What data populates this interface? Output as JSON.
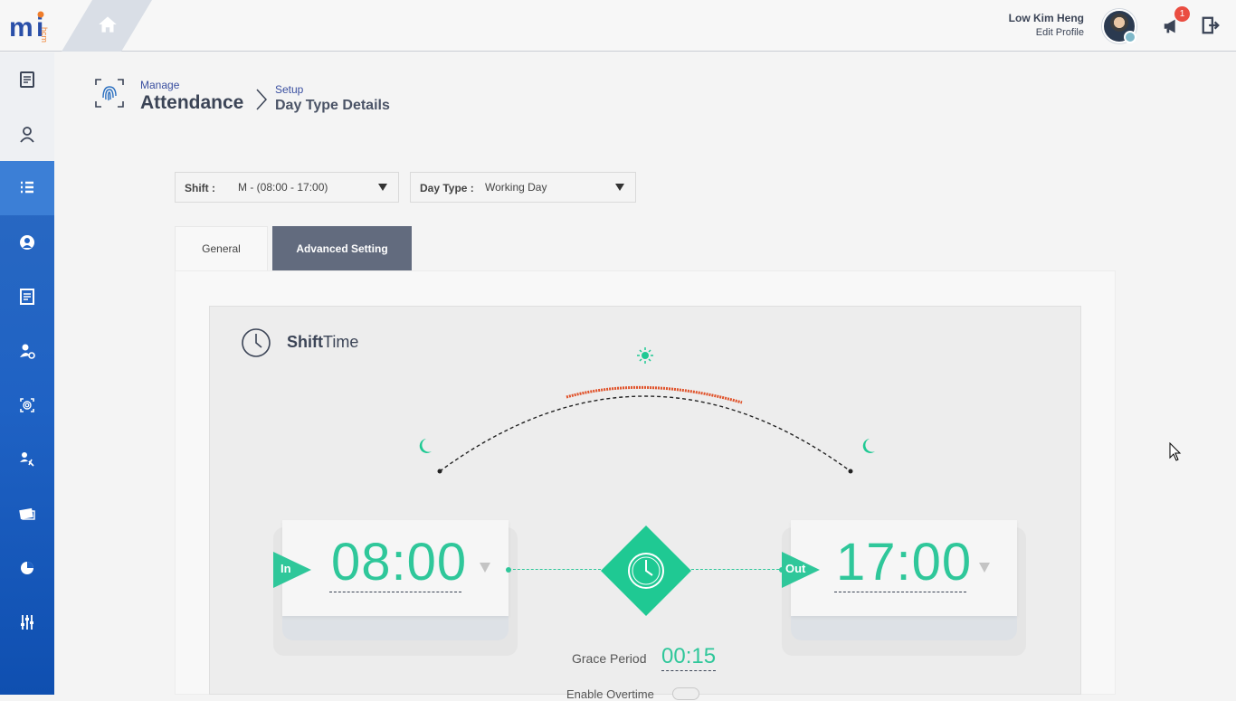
{
  "header": {
    "user_name": "Low Kim Heng",
    "edit_profile": "Edit Profile",
    "notifications_count": "1"
  },
  "breadcrumb": {
    "section": "Manage",
    "module": "Attendance",
    "subsection": "Setup",
    "page": "Day Type Details"
  },
  "filters": {
    "shift_label": "Shift :",
    "shift_value": "M - (08:00 - 17:00)",
    "daytype_label": "Day Type :",
    "daytype_value": "Working Day"
  },
  "tabs": [
    {
      "label": "General",
      "active": false
    },
    {
      "label": "Advanced Setting",
      "active": true
    }
  ],
  "shift_time": {
    "title_bold": "Shift",
    "title_rest": "Time",
    "in_label": "In",
    "in_time": "08:00",
    "out_label": "Out",
    "out_time": "17:00",
    "grace_label": "Grace Period",
    "grace_value": "00:15",
    "overtime_label": "Enable Overtime"
  },
  "sidebar": {
    "items": [
      {
        "icon": "notes-icon"
      },
      {
        "icon": "user-agent-icon"
      },
      {
        "icon": "list-icon"
      },
      {
        "icon": "profile-icon"
      },
      {
        "icon": "edit-document-icon"
      },
      {
        "icon": "user-settings-icon"
      },
      {
        "icon": "fingerprint-icon"
      },
      {
        "icon": "user-assign-icon"
      },
      {
        "icon": "payroll-icon"
      },
      {
        "icon": "pie-chart-icon"
      },
      {
        "icon": "sliders-icon"
      }
    ]
  },
  "colors": {
    "accent_green": "#2fc79a",
    "sidebar_blue": "#1f62c4",
    "arc_orange": "#e0522a",
    "tab_active": "#626b7e"
  }
}
